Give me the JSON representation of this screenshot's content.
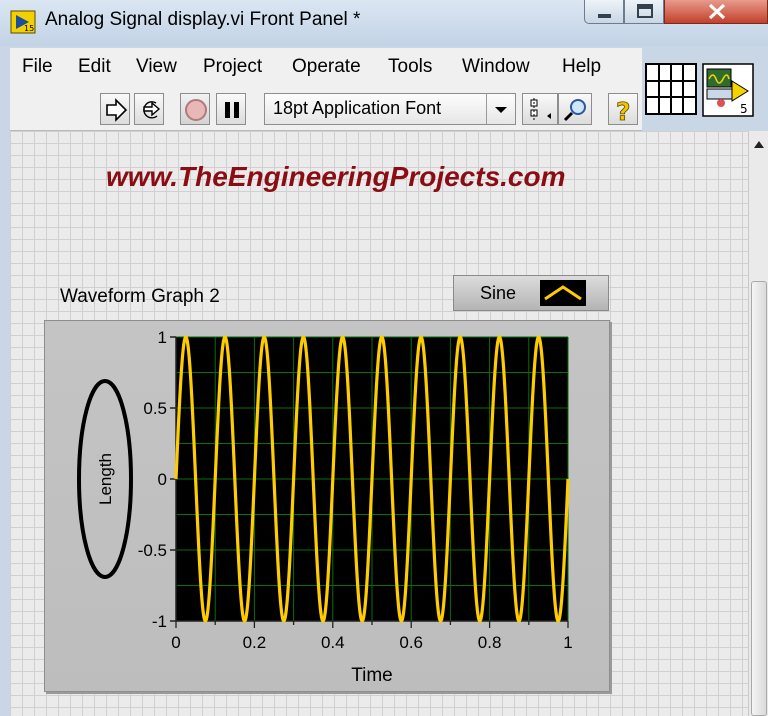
{
  "window": {
    "title": "Analog Signal display.vi Front Panel *"
  },
  "menu": {
    "items": [
      "File",
      "Edit",
      "View",
      "Project",
      "Operate",
      "Tools",
      "Window",
      "Help"
    ]
  },
  "toolbar": {
    "buttons": [
      "run-arrow-icon",
      "run-continuously-icon",
      "abort-icon",
      "pause-icon",
      "align-icon",
      "search-icon",
      "help-icon"
    ],
    "font_selector": "18pt Application Font"
  },
  "vi_icon": {
    "number": "5"
  },
  "watermark": {
    "text": "www.TheEngineeringProjects.com"
  },
  "graph": {
    "label": "Waveform Graph 2",
    "legend": {
      "name": "Sine",
      "color": "#ffcc00"
    }
  },
  "colors": {
    "plot_background": "#000000",
    "grid": "#0a6e0a",
    "trace": "#ffcc00",
    "annotation": "#000000",
    "watermark": "#8b0d14"
  },
  "chart_data": {
    "type": "line",
    "xlabel": "Time",
    "ylabel": "Length",
    "xlim": [
      0,
      1
    ],
    "ylim": [
      -1,
      1
    ],
    "x_ticks": [
      "0",
      "0.2",
      "0.4",
      "0.6",
      "0.8",
      "1"
    ],
    "y_ticks": [
      "1",
      "0.5",
      "0",
      "-0.5",
      "-1"
    ],
    "grid": true,
    "series": [
      {
        "name": "Sine",
        "function": "sine",
        "amplitude": 1,
        "frequency": 10,
        "phase": 0
      }
    ]
  }
}
